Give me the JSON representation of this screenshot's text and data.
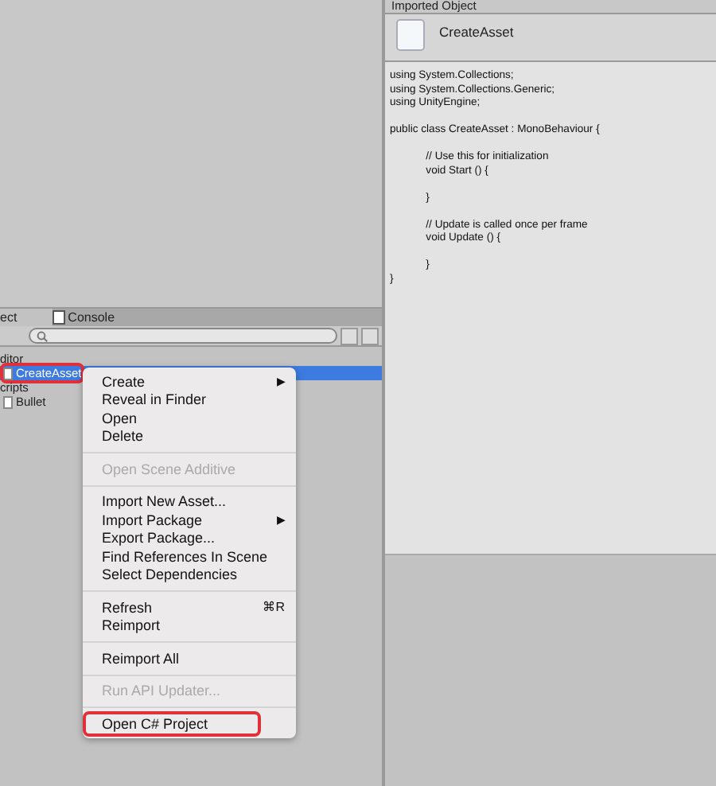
{
  "inspector": {
    "title": "Imported Object",
    "asset_name": "CreateAsset",
    "code": "using System.Collections;\nusing System.Collections.Generic;\nusing UnityEngine;\n\npublic class CreateAsset : MonoBehaviour {\n\n\t\t// Use this for initialization\n\t\tvoid Start () {\n\n\t\t}\n\n\t\t// Update is called once per frame\n\t\tvoid Update () {\n\n\t\t}\n}"
  },
  "tabs": [
    {
      "label": "ect",
      "selected": true
    },
    {
      "label": "Console",
      "selected": false
    }
  ],
  "tree": [
    {
      "label": "ditor",
      "selected": false,
      "annotated": false,
      "children": [
        {
          "label": "CreateAsset",
          "selected": true,
          "annotated": true
        }
      ]
    },
    {
      "label": "cripts",
      "selected": false,
      "annotated": false,
      "children": [
        {
          "label": "Bullet",
          "selected": false,
          "annotated": false
        }
      ]
    }
  ],
  "menu": [
    [
      {
        "label": "Create",
        "disabled": false,
        "annotated": false,
        "arrow": "▶"
      },
      {
        "label": "Reveal in Finder",
        "disabled": false,
        "annotated": false
      },
      {
        "label": "Open",
        "disabled": false,
        "annotated": false
      },
      {
        "label": "Delete",
        "disabled": false,
        "annotated": false
      }
    ],
    [
      {
        "label": "Open Scene Additive",
        "disabled": true,
        "annotated": false
      }
    ],
    [
      {
        "label": "Import New Asset...",
        "disabled": false,
        "annotated": false
      },
      {
        "label": "Import Package",
        "disabled": false,
        "annotated": false,
        "arrow": "▶"
      },
      {
        "label": "Export Package...",
        "disabled": false,
        "annotated": false
      },
      {
        "label": "Find References In Scene",
        "disabled": false,
        "annotated": false
      },
      {
        "label": "Select Dependencies",
        "disabled": false,
        "annotated": false
      }
    ],
    [
      {
        "label": "Refresh",
        "disabled": false,
        "annotated": false,
        "shortcut": "⌘R"
      },
      {
        "label": "Reimport",
        "disabled": false,
        "annotated": false
      }
    ],
    [
      {
        "label": "Reimport All",
        "disabled": false,
        "annotated": false
      }
    ],
    [
      {
        "label": "Run API Updater...",
        "disabled": true,
        "annotated": false
      }
    ],
    [
      {
        "label": "Open C# Project",
        "disabled": false,
        "annotated": true
      }
    ]
  ]
}
